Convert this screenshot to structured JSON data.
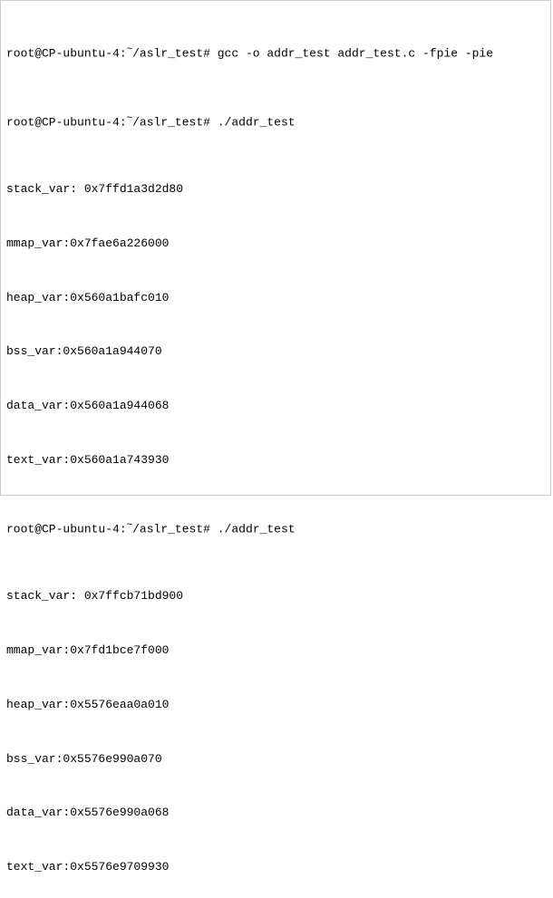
{
  "prompt1": {
    "user_host": "root@CP-ubuntu-4:",
    "tilde": "~",
    "path_hash": "/aslr_test# ",
    "command": "gcc -o addr_test addr_test.c -fpie -pie"
  },
  "prompt2": {
    "user_host": "root@CP-ubuntu-4:",
    "tilde": "~",
    "path_hash": "/aslr_test# ",
    "command": "./addr_test"
  },
  "run1": {
    "stack": "stack_var: 0x7ffd1a3d2d80",
    "mmap": "mmap_var:0x7fae6a226000",
    "heap": "heap_var:0x560a1bafc010",
    "bss": "bss_var:0x560a1a944070",
    "data": "data_var:0x560a1a944068",
    "text": "text_var:0x560a1a743930"
  },
  "prompt3": {
    "user_host": "root@CP-ubuntu-4:",
    "tilde": "~",
    "path_hash": "/aslr_test# ",
    "command": "./addr_test"
  },
  "run2": {
    "stack": "stack_var: 0x7ffcb71bd900",
    "mmap": "mmap_var:0x7fd1bce7f000",
    "heap": "heap_var:0x5576eaa0a010",
    "bss": "bss_var:0x5576e990a070",
    "data": "data_var:0x5576e990a068",
    "text": "text_var:0x5576e9709930"
  }
}
